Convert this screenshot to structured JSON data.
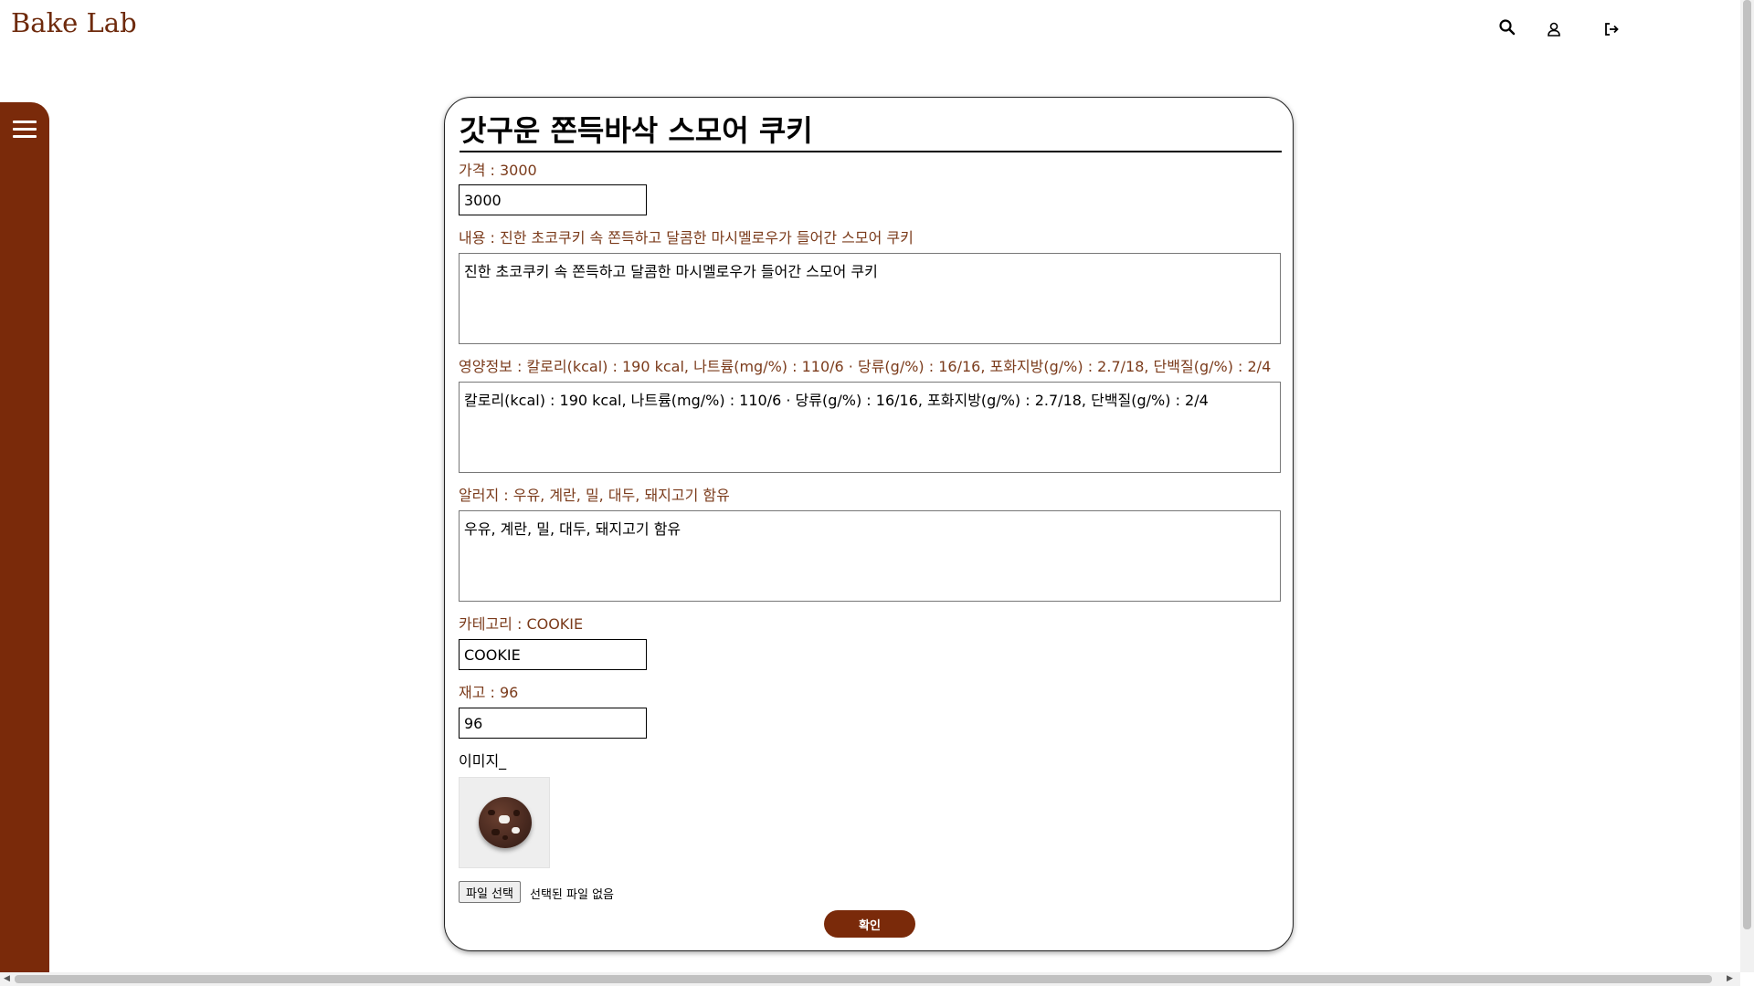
{
  "header": {
    "brand": "Bake Lab",
    "icons": [
      "search-icon",
      "user-icon",
      "logout-icon"
    ]
  },
  "sidebar": {
    "menu_icon": "hamburger-menu-icon"
  },
  "colors": {
    "brand": "#7a2a0a",
    "label": "#7b3b1b"
  },
  "form": {
    "title": "갓구운 쫀득바삭 스모어 쿠키",
    "price": {
      "label": "가격 : 3000",
      "value": "3000"
    },
    "content": {
      "label": "내용 : 진한 초코쿠키 속 쫀득하고 달콤한 마시멜로우가 들어간 스모어 쿠키",
      "value": "진한 초코쿠키 속 쫀득하고 달콤한 마시멜로우가 들어간 스모어 쿠키"
    },
    "nutrition": {
      "label": "영양정보 : 칼로리(kcal) : 190 kcal, 나트륨(mg/%) : 110/6 · 당류(g/%) : 16/16, 포화지방(g/%) : 2.7/18, 단백질(g/%) : 2/4",
      "value": "칼로리(kcal) : 190 kcal, 나트륨(mg/%) : 110/6 · 당류(g/%) : 16/16, 포화지방(g/%) : 2.7/18, 단백질(g/%) : 2/4"
    },
    "allergy": {
      "label": "알러지 : 우유, 계란, 밀, 대두, 돼지고기 함유",
      "value": "우유, 계란, 밀, 대두, 돼지고기 함유"
    },
    "category": {
      "label": "카테고리 : COOKIE",
      "value": "COOKIE"
    },
    "stock": {
      "label": "재고 : 96",
      "value": "96"
    },
    "image": {
      "label": "이미지_"
    },
    "file": {
      "button_label": "파일 선택",
      "status": "선택된 파일 없음"
    },
    "submit_label": "확인"
  }
}
